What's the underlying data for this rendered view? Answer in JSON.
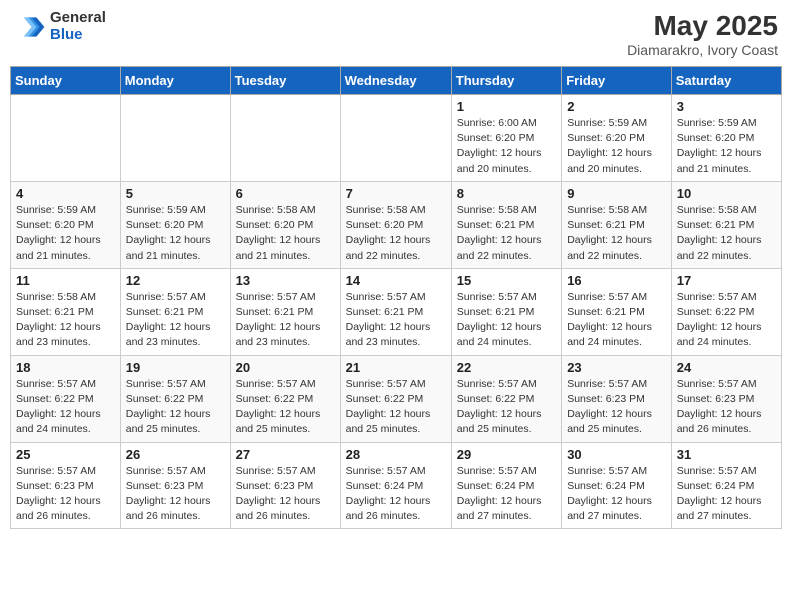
{
  "header": {
    "logo_general": "General",
    "logo_blue": "Blue",
    "title": "May 2025",
    "subtitle": "Diamarakro, Ivory Coast"
  },
  "weekdays": [
    "Sunday",
    "Monday",
    "Tuesday",
    "Wednesday",
    "Thursday",
    "Friday",
    "Saturday"
  ],
  "weeks": [
    [
      {
        "day": "",
        "info": ""
      },
      {
        "day": "",
        "info": ""
      },
      {
        "day": "",
        "info": ""
      },
      {
        "day": "",
        "info": ""
      },
      {
        "day": "1",
        "info": "Sunrise: 6:00 AM\nSunset: 6:20 PM\nDaylight: 12 hours\nand 20 minutes."
      },
      {
        "day": "2",
        "info": "Sunrise: 5:59 AM\nSunset: 6:20 PM\nDaylight: 12 hours\nand 20 minutes."
      },
      {
        "day": "3",
        "info": "Sunrise: 5:59 AM\nSunset: 6:20 PM\nDaylight: 12 hours\nand 21 minutes."
      }
    ],
    [
      {
        "day": "4",
        "info": "Sunrise: 5:59 AM\nSunset: 6:20 PM\nDaylight: 12 hours\nand 21 minutes."
      },
      {
        "day": "5",
        "info": "Sunrise: 5:59 AM\nSunset: 6:20 PM\nDaylight: 12 hours\nand 21 minutes."
      },
      {
        "day": "6",
        "info": "Sunrise: 5:58 AM\nSunset: 6:20 PM\nDaylight: 12 hours\nand 21 minutes."
      },
      {
        "day": "7",
        "info": "Sunrise: 5:58 AM\nSunset: 6:20 PM\nDaylight: 12 hours\nand 22 minutes."
      },
      {
        "day": "8",
        "info": "Sunrise: 5:58 AM\nSunset: 6:21 PM\nDaylight: 12 hours\nand 22 minutes."
      },
      {
        "day": "9",
        "info": "Sunrise: 5:58 AM\nSunset: 6:21 PM\nDaylight: 12 hours\nand 22 minutes."
      },
      {
        "day": "10",
        "info": "Sunrise: 5:58 AM\nSunset: 6:21 PM\nDaylight: 12 hours\nand 22 minutes."
      }
    ],
    [
      {
        "day": "11",
        "info": "Sunrise: 5:58 AM\nSunset: 6:21 PM\nDaylight: 12 hours\nand 23 minutes."
      },
      {
        "day": "12",
        "info": "Sunrise: 5:57 AM\nSunset: 6:21 PM\nDaylight: 12 hours\nand 23 minutes."
      },
      {
        "day": "13",
        "info": "Sunrise: 5:57 AM\nSunset: 6:21 PM\nDaylight: 12 hours\nand 23 minutes."
      },
      {
        "day": "14",
        "info": "Sunrise: 5:57 AM\nSunset: 6:21 PM\nDaylight: 12 hours\nand 23 minutes."
      },
      {
        "day": "15",
        "info": "Sunrise: 5:57 AM\nSunset: 6:21 PM\nDaylight: 12 hours\nand 24 minutes."
      },
      {
        "day": "16",
        "info": "Sunrise: 5:57 AM\nSunset: 6:21 PM\nDaylight: 12 hours\nand 24 minutes."
      },
      {
        "day": "17",
        "info": "Sunrise: 5:57 AM\nSunset: 6:22 PM\nDaylight: 12 hours\nand 24 minutes."
      }
    ],
    [
      {
        "day": "18",
        "info": "Sunrise: 5:57 AM\nSunset: 6:22 PM\nDaylight: 12 hours\nand 24 minutes."
      },
      {
        "day": "19",
        "info": "Sunrise: 5:57 AM\nSunset: 6:22 PM\nDaylight: 12 hours\nand 25 minutes."
      },
      {
        "day": "20",
        "info": "Sunrise: 5:57 AM\nSunset: 6:22 PM\nDaylight: 12 hours\nand 25 minutes."
      },
      {
        "day": "21",
        "info": "Sunrise: 5:57 AM\nSunset: 6:22 PM\nDaylight: 12 hours\nand 25 minutes."
      },
      {
        "day": "22",
        "info": "Sunrise: 5:57 AM\nSunset: 6:22 PM\nDaylight: 12 hours\nand 25 minutes."
      },
      {
        "day": "23",
        "info": "Sunrise: 5:57 AM\nSunset: 6:23 PM\nDaylight: 12 hours\nand 25 minutes."
      },
      {
        "day": "24",
        "info": "Sunrise: 5:57 AM\nSunset: 6:23 PM\nDaylight: 12 hours\nand 26 minutes."
      }
    ],
    [
      {
        "day": "25",
        "info": "Sunrise: 5:57 AM\nSunset: 6:23 PM\nDaylight: 12 hours\nand 26 minutes."
      },
      {
        "day": "26",
        "info": "Sunrise: 5:57 AM\nSunset: 6:23 PM\nDaylight: 12 hours\nand 26 minutes."
      },
      {
        "day": "27",
        "info": "Sunrise: 5:57 AM\nSunset: 6:23 PM\nDaylight: 12 hours\nand 26 minutes."
      },
      {
        "day": "28",
        "info": "Sunrise: 5:57 AM\nSunset: 6:24 PM\nDaylight: 12 hours\nand 26 minutes."
      },
      {
        "day": "29",
        "info": "Sunrise: 5:57 AM\nSunset: 6:24 PM\nDaylight: 12 hours\nand 27 minutes."
      },
      {
        "day": "30",
        "info": "Sunrise: 5:57 AM\nSunset: 6:24 PM\nDaylight: 12 hours\nand 27 minutes."
      },
      {
        "day": "31",
        "info": "Sunrise: 5:57 AM\nSunset: 6:24 PM\nDaylight: 12 hours\nand 27 minutes."
      }
    ]
  ]
}
